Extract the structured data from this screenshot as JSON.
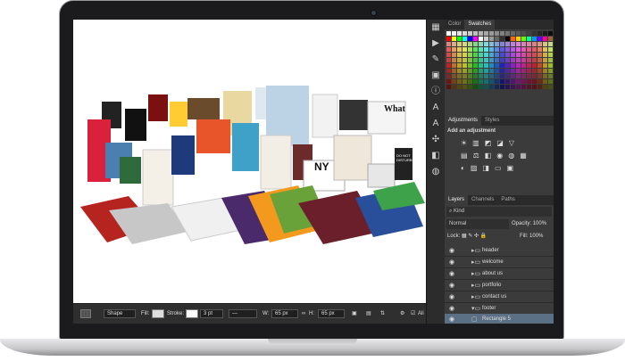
{
  "panels": {
    "color_tabs": [
      "Color",
      "Swatches"
    ],
    "adjust_tabs": [
      "Adjustments",
      "Styles"
    ],
    "adjust_title": "Add an adjustment",
    "layers_tabs": [
      "Layers",
      "Channels",
      "Paths"
    ],
    "kind_label": "Kind",
    "blend_mode": "Normal",
    "opacity_label": "Opacity:",
    "opacity_value": "100%",
    "lock_label": "Lock:",
    "fill_label": "Fill:",
    "fill_value": "100%",
    "layers": [
      "header",
      "welcome",
      "about us",
      "portfolio",
      "contact us",
      "footer",
      "Rectangle 5"
    ]
  },
  "options_bar": {
    "tool_mode": "Shape",
    "fill_label": "Fill:",
    "stroke_label": "Stroke:",
    "stroke_size": "3 pt",
    "w_label": "W:",
    "w_value": "65 px",
    "h_label": "H:",
    "h_value": "65 px",
    "align_label": "Ali"
  },
  "canvas": {
    "collage_texts": [
      "What",
      "NY",
      "DO NOT DISTURB"
    ]
  },
  "colors": {
    "accent_selection": "#5b6f85",
    "panel_bg": "#3b3b3b"
  }
}
